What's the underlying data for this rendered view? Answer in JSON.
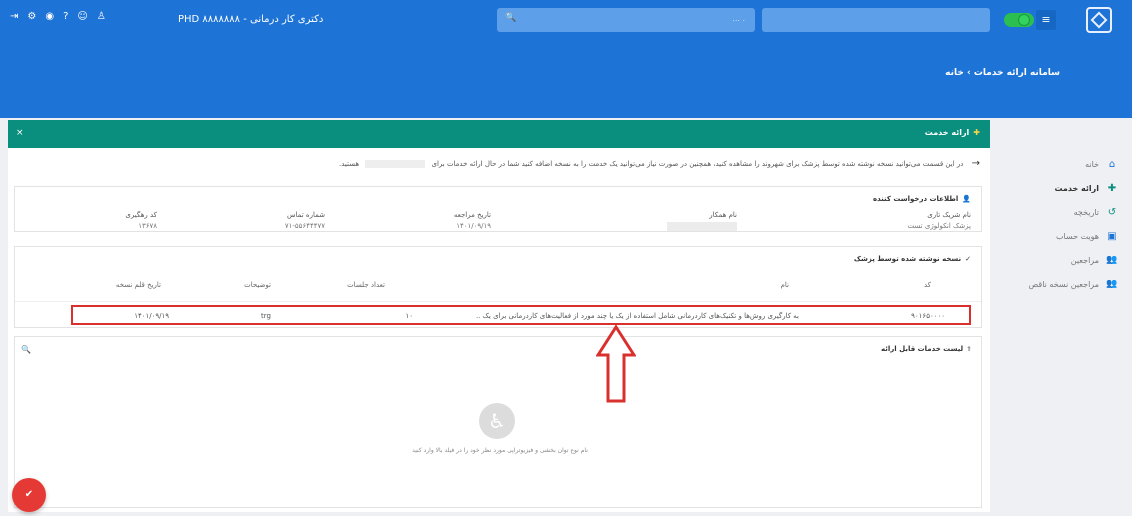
{
  "header": {
    "icons": [
      "login-icon",
      "gear-icon",
      "target-icon",
      "help-icon",
      "smile-icon",
      "person-icon"
    ],
    "icon_glyphs": [
      "⇥",
      "⚙",
      "◉",
      "?",
      "☺",
      "♙"
    ],
    "clinic_title": "دکتری کار درمانی - PHD ۸۸۸۸۸۸۸",
    "search_placeholder": "... .",
    "accent_color": "#1e73d6"
  },
  "breadcrumb": "سامانه ارائه خدمات › خانه",
  "panel": {
    "title": "ارائه خدمت",
    "close": "×",
    "header_color": "#0a8f7f"
  },
  "sidebar": {
    "items": [
      {
        "label": "خانه",
        "icon": "home-icon",
        "glyph": "⌂"
      },
      {
        "label": "ارائه خدمت",
        "icon": "basket-icon",
        "glyph": "✚"
      },
      {
        "label": "تاریخچه",
        "icon": "history-icon",
        "glyph": "↺"
      },
      {
        "label": "هویت حساب",
        "icon": "id-card-icon",
        "glyph": "▣"
      },
      {
        "label": "مراجعین",
        "icon": "people-icon",
        "glyph": "👥"
      },
      {
        "label": "مراجعین نسخه ناقص",
        "icon": "people-icon",
        "glyph": "👥"
      }
    ]
  },
  "info_text_before": "در این قسمت می‌توانید نسخه نوشته شده توسط پزشک برای شهروند را مشاهده کنید، همچنین در صورت نیاز می‌توانید یک خدمت را به نسخه اضافه کنید شما در حال ارائه خدمات برای",
  "info_text_after": "هستید.",
  "requester": {
    "title": "اطلاعات درخواست کننده",
    "fields": {
      "partner_label": "نام شریک تاری",
      "partner_value": "پزشک انکولوژی تست",
      "colleague_label": "نام همکار",
      "visit_date_label": "تاریخ مراجعه",
      "visit_date_value": "۱۴۰۱/۰۹/۱۹",
      "phone_label": "شماره تماس",
      "phone_value": "۷۱-۵۵۶۴۴۴۷۷",
      "tracking_label": "کد رهگیری",
      "tracking_value": "۱۳۶۷۸"
    }
  },
  "prescription": {
    "title": "نسخه نوشته شده توسط پزشک",
    "columns": {
      "code": "کد",
      "name": "نام",
      "sessions": "تعداد جلسات",
      "description": "توضیحات",
      "date": "تاریخ قلم نسخه"
    },
    "row": {
      "code": "۹۰۱۶۵۰۰۰۰",
      "name": "به کارگیری روش‌ها و تکنیک‌های کاردرمانی شامل استفاده از یک یا چند مورد از فعالیت‌های کاردرمانی برای یک ..",
      "sessions": "۱۰",
      "description": "trg",
      "date": "۱۴۰۱/۰۹/۱۹"
    }
  },
  "services": {
    "title": "لیست خدمات قابل ارائه",
    "empty_text": "نام نوع توان بخشی و فیزیوتراپی مورد نظر خود را در فیلد بالا وارد کنید"
  },
  "annotation_color": "#d9302e"
}
